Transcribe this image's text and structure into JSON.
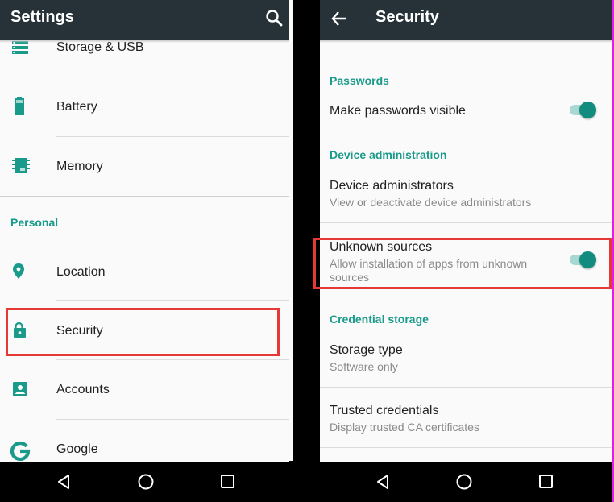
{
  "left": {
    "appbar": {
      "title": "Settings",
      "search_icon": "search-icon"
    },
    "items_device": [
      {
        "label": "Storage & USB",
        "icon": "storage-icon"
      },
      {
        "label": "Battery",
        "icon": "battery-icon"
      },
      {
        "label": "Memory",
        "icon": "memory-icon"
      }
    ],
    "section_personal": "Personal",
    "items_personal": [
      {
        "label": "Location",
        "icon": "location-pin-icon"
      },
      {
        "label": "Security",
        "icon": "lock-icon",
        "highlighted": true
      },
      {
        "label": "Accounts",
        "icon": "account-box-icon"
      },
      {
        "label": "Google",
        "icon": "google-g-icon"
      }
    ]
  },
  "right": {
    "appbar": {
      "title": "Security",
      "back_icon": "back-arrow-icon"
    },
    "sections": {
      "passwords": "Passwords",
      "device_admin": "Device administration",
      "credential_storage": "Credential storage"
    },
    "items": {
      "make_passwords_visible": {
        "title": "Make passwords visible",
        "toggle_on": true
      },
      "device_administrators": {
        "title": "Device administrators",
        "subtitle": "View or deactivate device administrators"
      },
      "unknown_sources": {
        "title": "Unknown sources",
        "subtitle_line1": "Allow installation of apps from unknown",
        "subtitle_line2": "sources",
        "toggle_on": true,
        "highlighted": true
      },
      "storage_type": {
        "title": "Storage type",
        "subtitle": "Software only"
      },
      "trusted_credentials": {
        "title": "Trusted credentials",
        "subtitle": "Display trusted CA certificates"
      }
    }
  },
  "navbar": {
    "back": "nav-back-icon",
    "home": "nav-home-icon",
    "recents": "nav-recents-icon"
  },
  "colors": {
    "accent": "#1a9a8a",
    "appbar": "#263238",
    "highlight": "#e53935",
    "toggle_thumb": "#128c7e"
  }
}
